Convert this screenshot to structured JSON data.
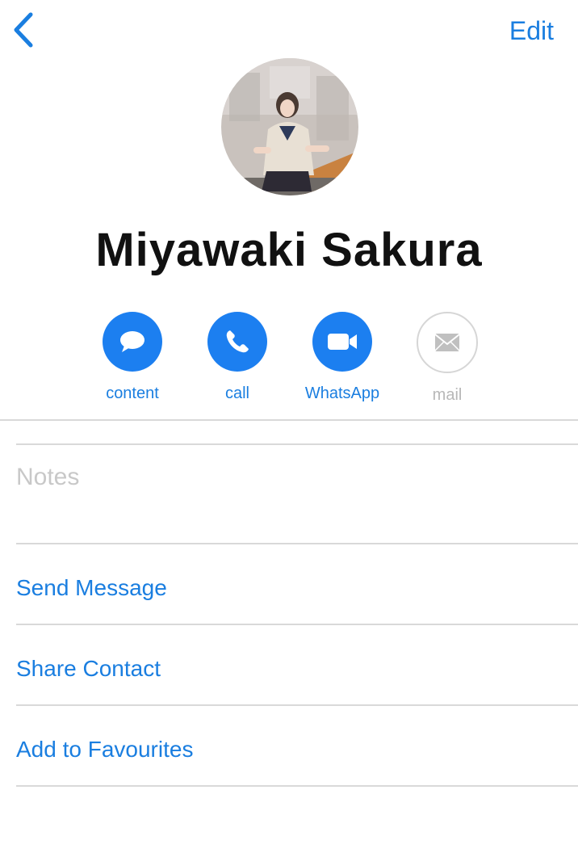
{
  "nav": {
    "back_icon": "chevron-left-icon",
    "edit_label": "Edit"
  },
  "contact": {
    "name": "Miyawaki Sakura",
    "avatar": "profile-photo"
  },
  "actions": [
    {
      "label": "content",
      "icon": "message-bubble-icon",
      "enabled": true
    },
    {
      "label": "call",
      "icon": "phone-icon",
      "enabled": true
    },
    {
      "label": "WhatsApp",
      "icon": "video-camera-icon",
      "enabled": true
    },
    {
      "label": "mail",
      "icon": "envelope-icon",
      "enabled": false
    }
  ],
  "notes": {
    "placeholder": "Notes"
  },
  "rows": [
    {
      "label": "Send Message"
    },
    {
      "label": "Share Contact"
    },
    {
      "label": "Add to Favourites"
    }
  ],
  "colors": {
    "accent": "#1c7ff0",
    "text": "#111111",
    "muted": "#c8c8c8",
    "divider": "#d9d9d9"
  }
}
